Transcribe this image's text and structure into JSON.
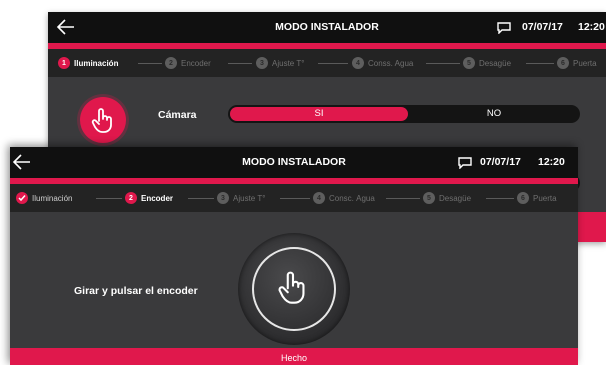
{
  "back_screen": {
    "title": "MODO INSTALADOR",
    "date": "07/07/17",
    "time": "12:20",
    "steps": [
      {
        "num": "1",
        "label": "Iluminación"
      },
      {
        "num": "2",
        "label": "Encoder"
      },
      {
        "num": "3",
        "label": "Ajuste T°"
      },
      {
        "num": "4",
        "label": "Conss. Agua"
      },
      {
        "num": "5",
        "label": "Desagüe"
      },
      {
        "num": "6",
        "label": "Puerta"
      }
    ],
    "camera_label": "Cámara",
    "toggle_on": "SI",
    "toggle_off": "NO"
  },
  "front_screen": {
    "title": "MODO INSTALADOR",
    "date": "07/07/17",
    "time": "12:20",
    "steps": [
      {
        "num": "",
        "label": "Iluminación"
      },
      {
        "num": "2",
        "label": "Encoder"
      },
      {
        "num": "3",
        "label": "Ajuste T°"
      },
      {
        "num": "4",
        "label": "Consс. Agua"
      },
      {
        "num": "5",
        "label": "Desagüe"
      },
      {
        "num": "6",
        "label": "Puerta"
      }
    ],
    "instruction": "Girar y pulsar el encoder",
    "done_button": "Hecho"
  },
  "icons": {
    "back": "arrow-left-icon",
    "message": "message-icon",
    "touch": "hand-pointer-icon",
    "check": "check-icon"
  },
  "colors": {
    "accent": "#e0184c",
    "titlebar": "#101010",
    "body": "#3a3a3c"
  }
}
